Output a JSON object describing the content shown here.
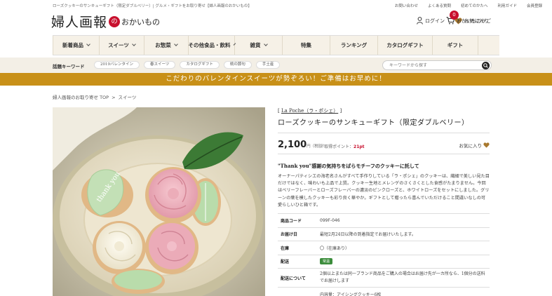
{
  "top": {
    "description": "ローズクッキーのサンキューギフト（限定ダブルベリー）| グルメ・ギフトをお取り寄せ【婦人画報のおかいもの】",
    "links": [
      "お問い合わせ",
      "よくある質問",
      "初めてのかたへ",
      "利用ガイド",
      "会員登録"
    ]
  },
  "logo": {
    "main": "婦人画報",
    "no": "の",
    "sub": "おかいもの"
  },
  "header": {
    "login": "ログイン",
    "favorites": "お気に入り",
    "cart": "おかいものかご",
    "cart_count": "0"
  },
  "nav": [
    {
      "label": "新着商品",
      "dropdown": true
    },
    {
      "label": "スイーツ",
      "dropdown": true
    },
    {
      "label": "お惣菜",
      "dropdown": true
    },
    {
      "label": "その他食品・飲料",
      "dropdown": true
    },
    {
      "label": "雑貨",
      "dropdown": true
    },
    {
      "label": "特集",
      "dropdown": false
    },
    {
      "label": "ランキング",
      "dropdown": false
    },
    {
      "label": "カタログギフト",
      "dropdown": false
    },
    {
      "label": "ギフト",
      "dropdown": false
    }
  ],
  "keywords": {
    "label": "話題キーワード",
    "tags": [
      "2019バレンタイン",
      "春スイーツ",
      "カタログギフト",
      "桃の節句",
      "手土産"
    ],
    "search_placeholder": "キーワードから探す"
  },
  "banner": "こだわりのバレンタインスイーツが勢ぞろい！ご準備はお早めに！",
  "breadcrumb": [
    "婦人画報のお取り寄せ TOP",
    "スイーツ"
  ],
  "product": {
    "brand": "La Poche（ラ・ポシェ）",
    "title": "ローズクッキーのサンキューギフト（限定ダブルベリー）",
    "price": "2,100",
    "price_unit": "円",
    "price_tax": "（税別）",
    "points_label": "／取得ポイント：",
    "points": "21pt",
    "favorite": "お気に入り",
    "catch": "\"Thank you\"感謝の気持ちをばらモチーフのクッキーに託して",
    "description": "オーナーパティシエの海老名さんがすべて手作りしている「ラ・ポシェ」のクッキーは、繊細で美しい見た目だけではなく、味わいも上品で上質。クッキー生地とメレンゲのさくさくとした食感がたまりません。今回はベリーフレーバーとローズフレーバーの濃淡のピンクローズと、ホワイトローズをセットにしました。グリーンの葉を模したクッキーも彩り良く華やか。ギフトとして贈ったら喜んでいただけること間違いなしの可愛らしいひと箱です。",
    "specs": [
      {
        "key": "商品コード",
        "value": "099F-046"
      },
      {
        "key": "お届け日",
        "value": "最短2月24日以降の到着指定でお届けいたします。"
      },
      {
        "key": "在庫",
        "value": "〇（在庫あり）"
      },
      {
        "key": "配送",
        "value": "常温"
      },
      {
        "key": "配送について",
        "value": "2個以上または同一ブランド商品をご購入の場合はお届け先が一カ所なら、1個分の送料でお届けします"
      },
      {
        "key": "",
        "value": "内容量：アイシングクッキー6枚"
      }
    ]
  },
  "colors": {
    "accent": "#c8102e",
    "banner": "#c89018",
    "nav_bg": "#f6f1e7",
    "stock": "#3b8c3b"
  }
}
